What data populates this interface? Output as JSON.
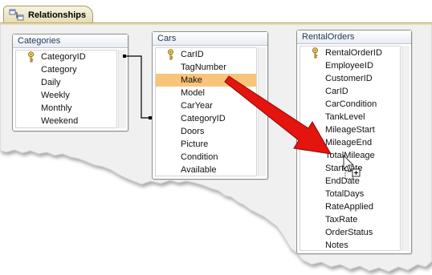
{
  "tab": {
    "title": "Relationships",
    "icon": "relationships-icon"
  },
  "tables": [
    {
      "name": "Categories",
      "fields": [
        {
          "label": "CategoryID",
          "primary_key": true
        },
        {
          "label": "Category"
        },
        {
          "label": "Daily"
        },
        {
          "label": "Weekly"
        },
        {
          "label": "Monthly"
        },
        {
          "label": "Weekend"
        }
      ]
    },
    {
      "name": "Cars",
      "fields": [
        {
          "label": "CarID",
          "primary_key": true
        },
        {
          "label": "TagNumber"
        },
        {
          "label": "Make",
          "selected": true
        },
        {
          "label": "Model"
        },
        {
          "label": "CarYear"
        },
        {
          "label": "CategoryID"
        },
        {
          "label": "Doors"
        },
        {
          "label": "Picture"
        },
        {
          "label": "Condition"
        },
        {
          "label": "Available"
        }
      ]
    },
    {
      "name": "RentalOrders",
      "fields": [
        {
          "label": "RentalOrderID",
          "primary_key": true
        },
        {
          "label": "EmployeeID"
        },
        {
          "label": "CustomerID"
        },
        {
          "label": "CarID"
        },
        {
          "label": "CarCondition"
        },
        {
          "label": "TankLevel"
        },
        {
          "label": "MileageStart"
        },
        {
          "label": "MileageEnd"
        },
        {
          "label": "TotalMileage"
        },
        {
          "label": "StartDate"
        },
        {
          "label": "EndDate"
        },
        {
          "label": "TotalDays"
        },
        {
          "label": "RateApplied"
        },
        {
          "label": "TaxRate"
        },
        {
          "label": "OrderStatus"
        },
        {
          "label": "Notes"
        }
      ]
    }
  ],
  "colors": {
    "selected_field": "#f8c47a",
    "drag_arrow": "#e4140e",
    "window_bg": "#f0f0f0",
    "title_text": "#1e395b"
  }
}
